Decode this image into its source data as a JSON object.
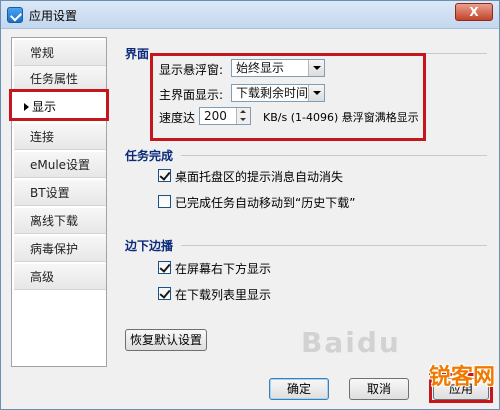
{
  "window": {
    "title": "应用设置",
    "close_label": "X"
  },
  "sidebar": {
    "items": [
      {
        "label": "常规"
      },
      {
        "label": "任务属性"
      },
      {
        "label": "显示",
        "active": true
      },
      {
        "label": "连接"
      },
      {
        "label": "eMule设置"
      },
      {
        "label": "BT设置"
      },
      {
        "label": "离线下载"
      },
      {
        "label": "病毒保护"
      },
      {
        "label": "高级"
      }
    ]
  },
  "sections": {
    "ui": {
      "title": "界面",
      "float_label": "显示悬浮窗:",
      "float_value": "始终显示",
      "main_label": "主界面显示:",
      "main_value": "下载剩余时间",
      "speed_prefix": "速度达",
      "speed_value": "200",
      "speed_suffix": "KB/s (1-4096) 悬浮窗满格显示"
    },
    "task_done": {
      "title": "任务完成",
      "opt1": {
        "label": "桌面托盘区的提示消息自动消失",
        "checked": true
      },
      "opt2": {
        "label": "已完成任务自动移动到“历史下载”",
        "checked": false
      }
    },
    "edge": {
      "title": "边下边播",
      "opt1": {
        "label": "在屏幕右下方显示",
        "checked": true
      },
      "opt2": {
        "label": "在下载列表里显示",
        "checked": true
      }
    }
  },
  "buttons": {
    "restore": "恢复默认设置",
    "ok": "确定",
    "cancel": "取消",
    "apply": "应用"
  },
  "watermark": {
    "text": "锐客网",
    "faint": "Baidu"
  },
  "colors": {
    "highlight_red": "#c4161c",
    "section_title": "#0b2a7a",
    "watermark": "#f07a00"
  }
}
